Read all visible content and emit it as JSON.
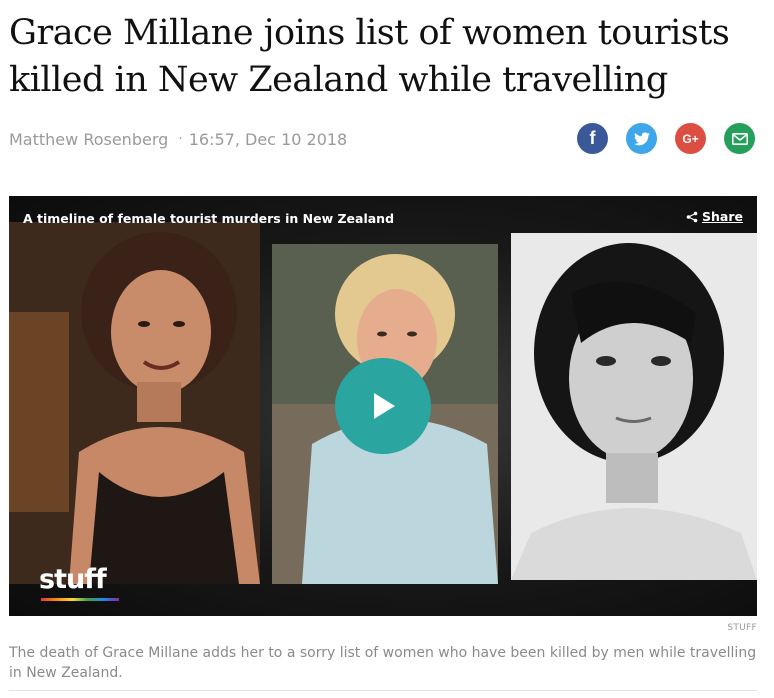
{
  "article": {
    "headline": "Grace Millane joins list of women tourists killed in New Zealand while travelling",
    "author": "Matthew Rosenberg",
    "separator": "·",
    "timestamp": "16:57, Dec 10 2018"
  },
  "share_icons": [
    {
      "name": "facebook",
      "glyph": "f",
      "color": "#3b5998"
    },
    {
      "name": "twitter",
      "glyph": "twitter-bird-icon",
      "color": "#3fa6e9"
    },
    {
      "name": "google-plus",
      "glyph": "G+",
      "color": "#dc4e41"
    },
    {
      "name": "email",
      "glyph": "envelope-icon",
      "color": "#24a05a"
    }
  ],
  "video": {
    "title": "A timeline of female tourist murders in New Zealand",
    "share_label": "Share",
    "logo_text": "stuff",
    "play_color": "#2aa5a0"
  },
  "media_credit": "STUFF",
  "caption": "The death of Grace Millane adds her to a sorry list of women who have been killed by men while travelling in New Zealand."
}
